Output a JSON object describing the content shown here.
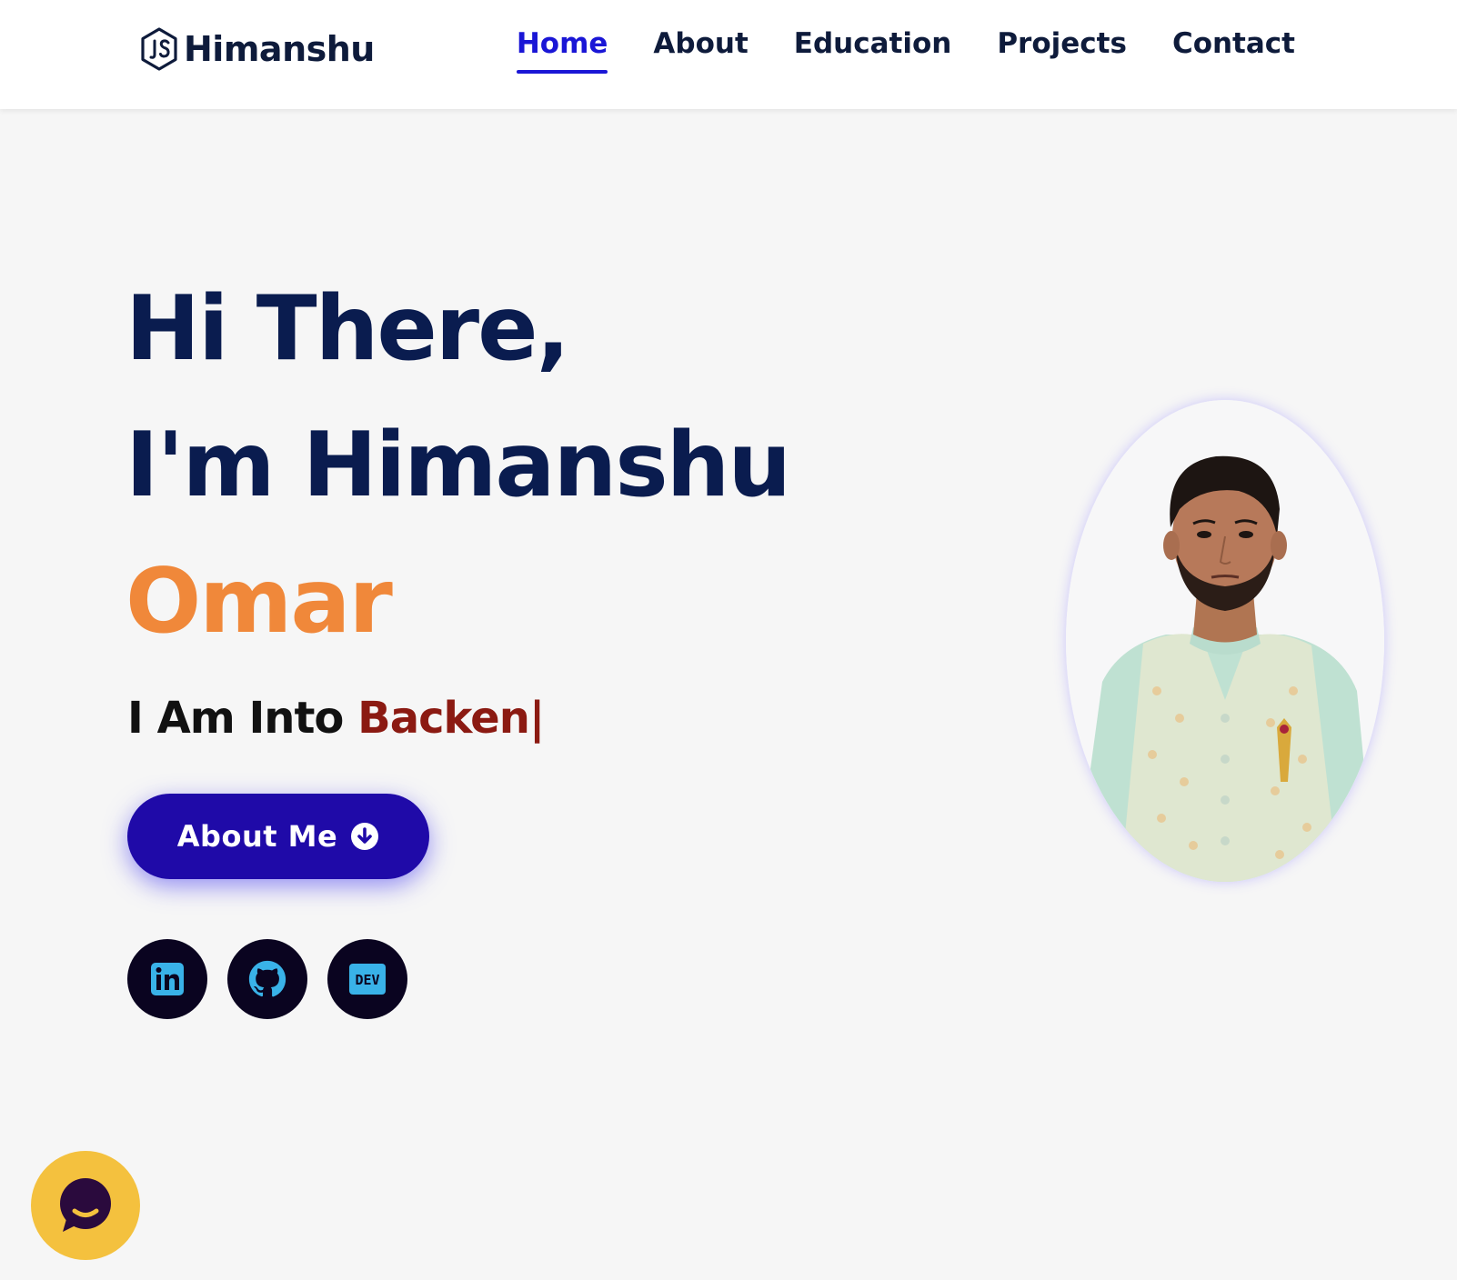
{
  "header": {
    "logo_text": "Himanshu",
    "logo_icon": "js-hexagon-icon",
    "nav": [
      {
        "label": "Home",
        "active": true
      },
      {
        "label": "About",
        "active": false
      },
      {
        "label": "Education",
        "active": false
      },
      {
        "label": "Projects",
        "active": false
      },
      {
        "label": "Contact",
        "active": false
      }
    ]
  },
  "hero": {
    "line1": "Hi There,",
    "line2": "I'm Himanshu",
    "line3": "Omar",
    "typing_prefix": "I Am Into ",
    "typing_text": "Backen",
    "typing_caret": "|",
    "button_label": "About Me",
    "button_icon": "arrow-down-circle-icon",
    "socials": [
      {
        "name": "linkedin-icon"
      },
      {
        "name": "github-icon"
      },
      {
        "name": "dev-icon",
        "label": "DEV"
      }
    ]
  },
  "colors": {
    "nav_active": "#1a16d6",
    "heading": "#0a1c4f",
    "accent_name": "#f0883a",
    "typed_text": "#8b1a12",
    "button_bg": "#1f0aa8",
    "social_bg": "#0a0420",
    "social_icon": "#39b2e8",
    "chat_bg": "#f4c13e"
  },
  "chat_widget": {
    "icon": "chat-bubble-icon"
  }
}
